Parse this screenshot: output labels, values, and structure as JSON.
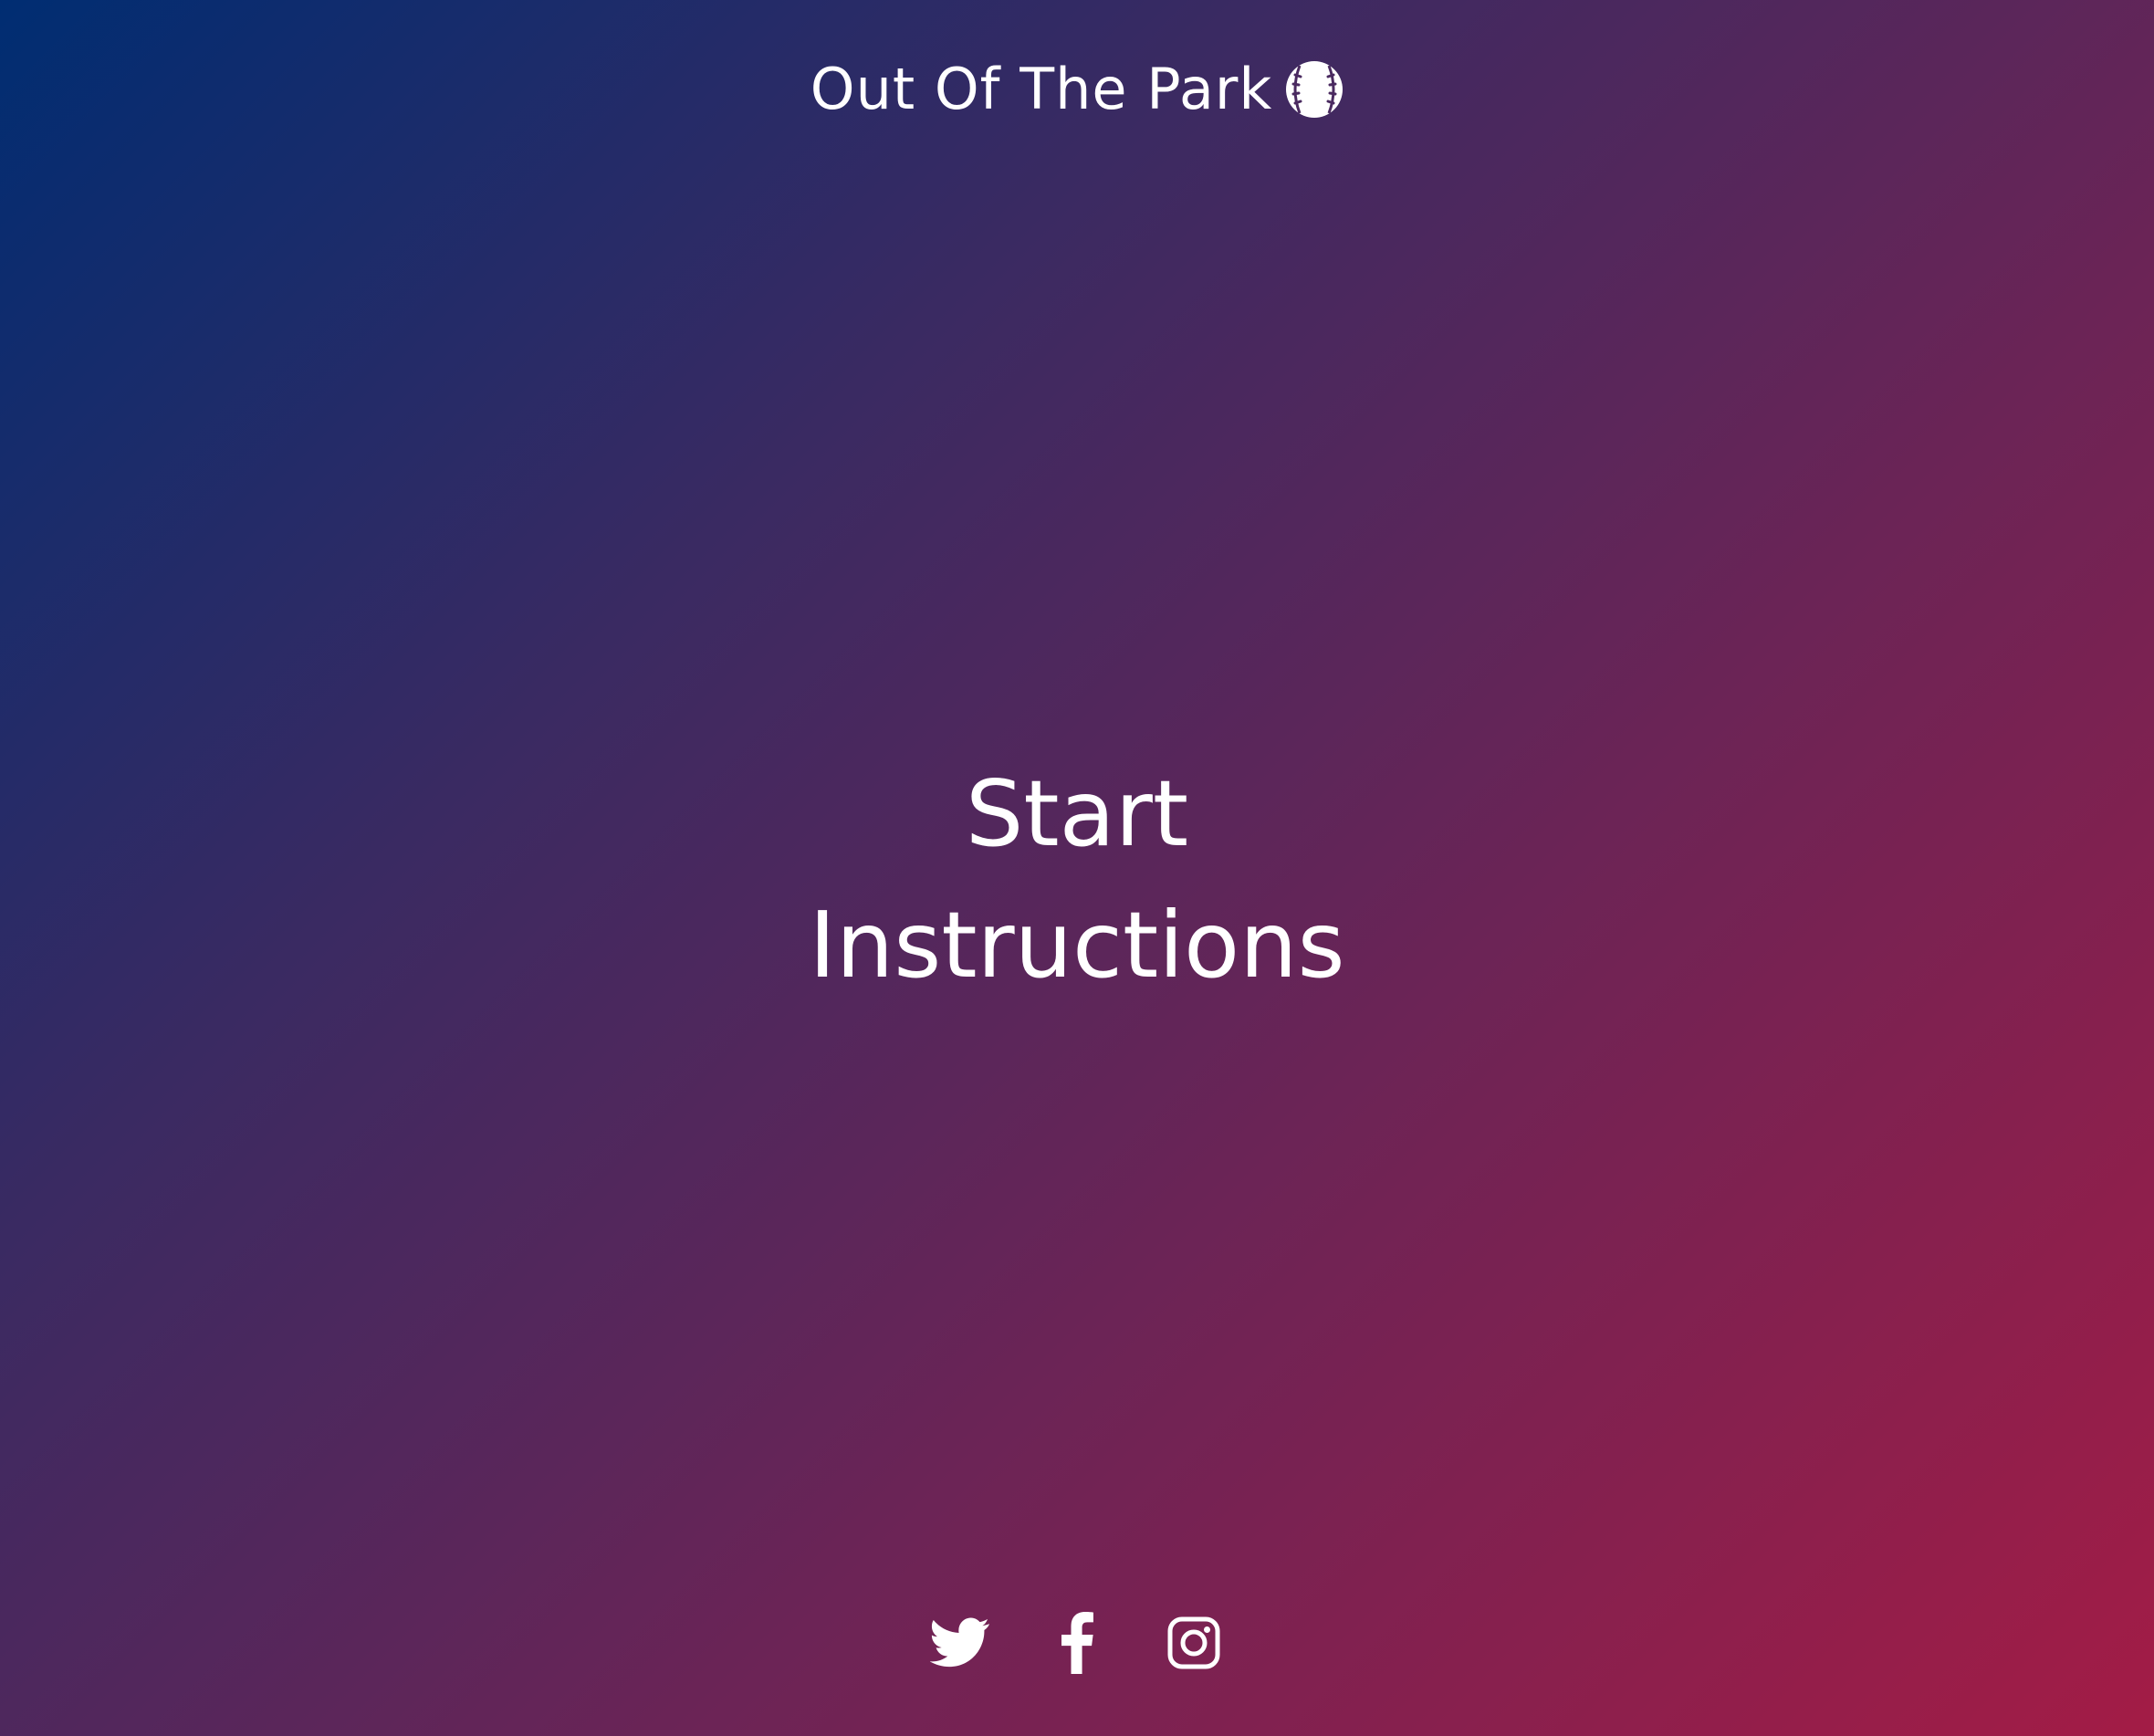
{
  "header": {
    "title": "Out Of The Park",
    "logo_icon": "baseball-icon"
  },
  "menu": {
    "items": [
      {
        "label": "Start"
      },
      {
        "label": "Instructions"
      }
    ]
  },
  "social": {
    "links": [
      {
        "icon": "twitter-icon"
      },
      {
        "icon": "facebook-icon"
      },
      {
        "icon": "instagram-icon"
      }
    ]
  },
  "colors": {
    "gradient_start": "#002d72",
    "gradient_end": "#a31c46",
    "text": "#ffffff"
  }
}
